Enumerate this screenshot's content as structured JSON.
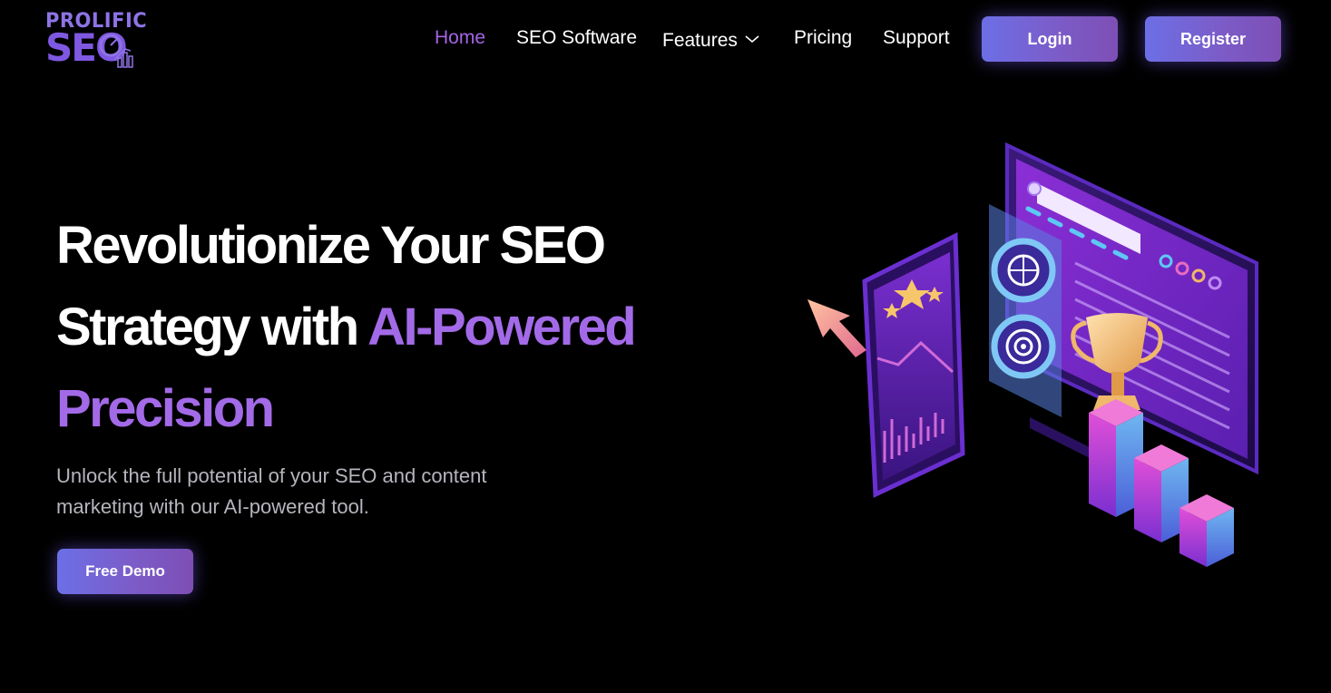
{
  "brand": {
    "logo_top": "PROLIFIC",
    "logo_main": "SEO"
  },
  "nav": {
    "items": [
      {
        "label": "Home",
        "active": true
      },
      {
        "label": "SEO Software",
        "active": false
      },
      {
        "label": "Features",
        "active": false,
        "has_dropdown": true
      },
      {
        "label": "Pricing",
        "active": false
      },
      {
        "label": "Support",
        "active": false
      }
    ],
    "login_label": "Login",
    "register_label": "Register"
  },
  "hero": {
    "title_line1": "Revolutionize Your SEO",
    "title_line2_plain": "Strategy with ",
    "title_line2_accent": "AI-Powered",
    "title_line3_accent": "Precision",
    "subtitle_line1": "Unlock the full potential of your SEO and content",
    "subtitle_line2": "marketing with our AI-powered tool.",
    "cta_label": "Free Demo"
  },
  "colors": {
    "background": "#000000",
    "accent": "#a36ae8",
    "nav_active": "#a465e6",
    "button_gradient_start": "#6c6fe6",
    "button_gradient_end": "#7d4fb5",
    "subtitle": "#b5b5bd"
  },
  "icons": {
    "dropdown": "chevron-down-icon",
    "illustration": "seo-analytics-illustration"
  }
}
